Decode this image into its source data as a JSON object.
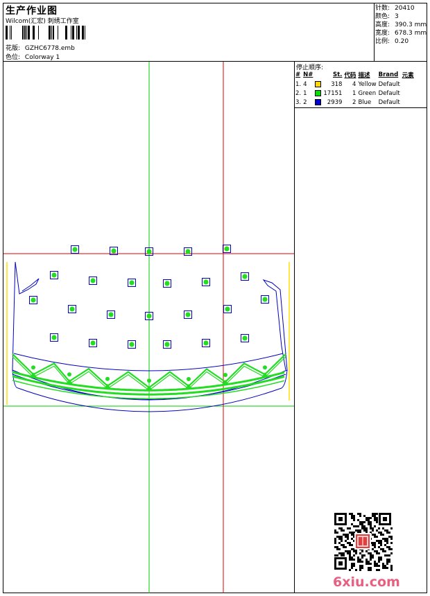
{
  "header": {
    "title": "生产作业图",
    "subtitle": "Wilcom(汇宏) 刺绣工作室",
    "design_label": "花版:",
    "design_value": "GZHC6778.emb",
    "colorway_label": "色位:",
    "colorway_value": "Colorway 1"
  },
  "stats": [
    {
      "label": "针数:",
      "value": "20410"
    },
    {
      "label": "颜色:",
      "value": "3"
    },
    {
      "label": "高度:",
      "value": "390.3 mm"
    },
    {
      "label": "宽度:",
      "value": "678.3 mm"
    },
    {
      "label": "比例:",
      "value": "0.20"
    }
  ],
  "stop_sequence": {
    "title": "停止顺序:",
    "headers": [
      "#",
      "N#",
      "St.",
      "代码",
      "描述",
      "Brand",
      "元素"
    ],
    "rows": [
      {
        "idx": "1.",
        "n": "4",
        "st": "318",
        "code": "4",
        "desc": "Yellow",
        "brand": "Default",
        "color": "#ffd800"
      },
      {
        "idx": "2.",
        "n": "1",
        "st": "17151",
        "code": "1",
        "desc": "Green",
        "brand": "Default",
        "color": "#00e000"
      },
      {
        "idx": "3.",
        "n": "2",
        "st": "2939",
        "code": "2",
        "desc": "Blue",
        "brand": "Default",
        "color": "#0000d0"
      }
    ]
  },
  "watermark": {
    "text": "6xiu.com"
  },
  "colors": {
    "guide_green": "#00cc00",
    "guide_red": "#e00000",
    "outline_blue": "#0000c0",
    "motif_green": "#22dd22",
    "yellow_guide": "#ffe000"
  },
  "icons": [
    "qr-code-icon",
    "seal-stamp-icon"
  ]
}
